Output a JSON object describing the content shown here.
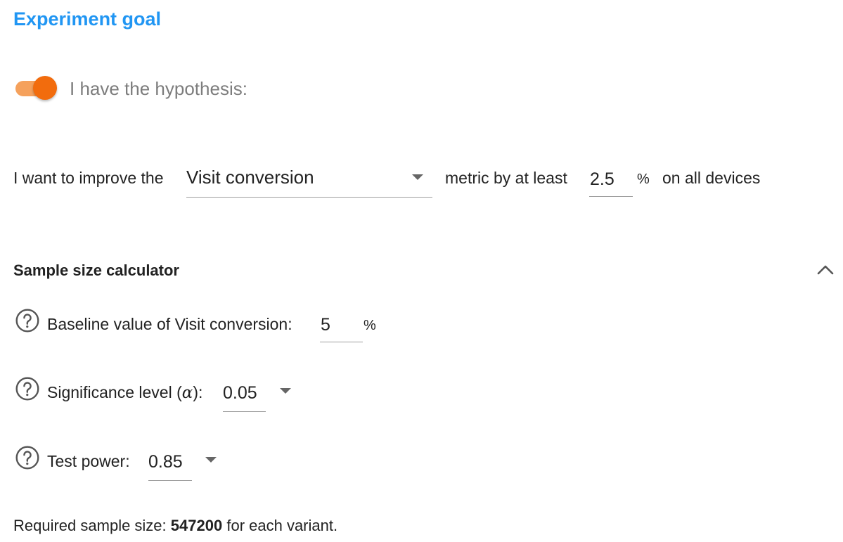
{
  "header": {
    "title": "Experiment goal"
  },
  "hypothesis": {
    "toggle_on": true,
    "label": "I have the hypothesis:",
    "track_color": "#f5a15c",
    "thumb_color": "#f26c0d"
  },
  "goal": {
    "prefix": "I want to improve the",
    "metric_selected": "Visit conversion",
    "middle": "metric by at least",
    "improvement_value": "2.5",
    "percent_sign": "%",
    "suffix": "on all devices"
  },
  "calculator": {
    "title": "Sample size calculator",
    "baseline": {
      "label": "Baseline value of Visit conversion:",
      "value": "5",
      "percent_sign": "%"
    },
    "significance": {
      "label_prefix": "Significance level (",
      "alpha_symbol": "α",
      "label_suffix": "):",
      "selected": "0.05"
    },
    "power": {
      "label": "Test power:",
      "selected": "0.85"
    },
    "result": {
      "prefix": "Required sample size:",
      "value": "547200",
      "suffix": "for each variant."
    }
  },
  "colors": {
    "title_blue": "#2196f3",
    "text": "#222222",
    "muted_text": "#7d7d7d",
    "underline": "#9e9e9e",
    "caret": "#666666"
  },
  "icons": {
    "help": "help-circle-icon",
    "collapse": "chevron-up-icon",
    "dropdown": "caret-down-icon"
  }
}
